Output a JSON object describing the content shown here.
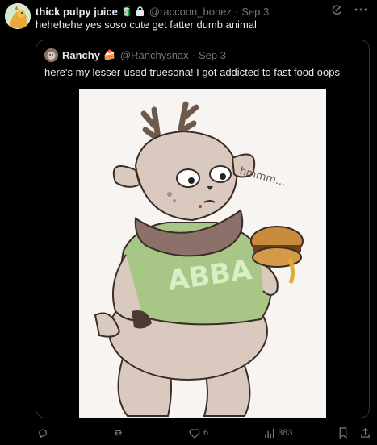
{
  "post": {
    "author_name": "thick pulpy juice",
    "author_emoji": "🧃",
    "handle": "@raccoon_bonez",
    "separator": "·",
    "time": "Sep 3",
    "text": "hehehehe yes soso cute get fatter dumb animal"
  },
  "quote": {
    "author_name": "Ranchy",
    "author_emoji": "🍰",
    "handle": "@Ranchysnax",
    "separator": "·",
    "time": "Sep 3",
    "text": "here's my lesser-used truesona! I got addicted to fast food oops",
    "media": {
      "drawn_text": [
        "ABBA",
        "hmmm..."
      ]
    }
  },
  "actions": {
    "reply_count": "",
    "repost_count": "",
    "like_count": "6",
    "views_count": "383"
  },
  "icons": [
    "lock-icon",
    "grok-icon",
    "more-icon",
    "reply-icon",
    "repost-icon",
    "like-icon",
    "views-icon",
    "bookmark-icon",
    "share-icon"
  ],
  "colors": {
    "muted": "#71767b",
    "text": "#e7e9ea",
    "border": "#2f3336",
    "background": "#000000"
  }
}
